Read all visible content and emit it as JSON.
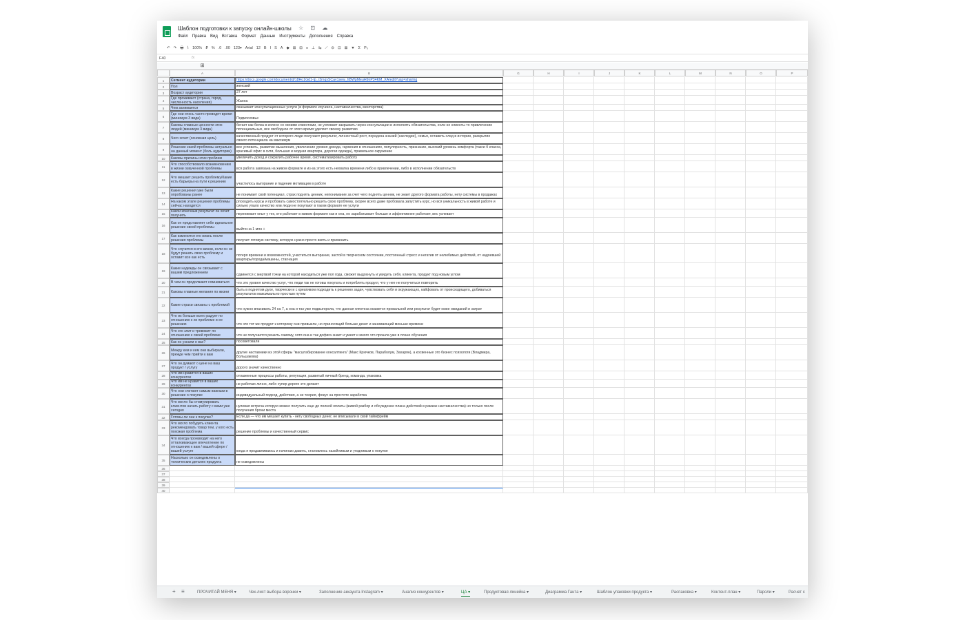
{
  "title": "Шаблон подготовки к запуску онлайн-школы",
  "title_icons": "☆ ⊡ ☁",
  "menu": [
    "Файл",
    "Правка",
    "Вид",
    "Вставка",
    "Формат",
    "Данные",
    "Инструменты",
    "Дополнения",
    "Справка"
  ],
  "toolbar": [
    "↶",
    "↷",
    "🖶",
    "⌇",
    "100%",
    "₽",
    "%",
    ".0",
    ".00",
    "123▾",
    "Arial",
    "12",
    "B",
    "I",
    "S",
    "A",
    "◆",
    "⊞",
    "⊟",
    "≡",
    "⊥",
    "⇆",
    "⟋",
    "⊖",
    "⊡",
    "⊠",
    "▼",
    "Σ",
    "Р₀"
  ],
  "formula": {
    "cell_ref": "F40",
    "fx": "fx"
  },
  "columns": [
    "A",
    "B",
    "G",
    "H",
    "I",
    "J",
    "K",
    "L",
    "M",
    "N",
    "O",
    "P"
  ],
  "rows": [
    {
      "n": "1",
      "q": "Сегмент аудитории",
      "a": "https://docs.google.com/document/d/18Ho1Gd1-lp_r3mqySCav1sew_hBWpMeuH9nP34KM_XA/edit?usp=sharing"
    },
    {
      "n": "2",
      "q": "Пол",
      "a": "женский"
    },
    {
      "n": "3",
      "q": "Возраст аудитории",
      "a": "27 лет"
    },
    {
      "n": "4",
      "q": "Где проживают (страна, город, численность населения)",
      "a": "Жанна"
    },
    {
      "n": "5",
      "q": "Чем занимается",
      "a": "оказывает консультационные услуги (в формате коучинга, наставничества, менторства)"
    },
    {
      "n": "6",
      "q": "Где они очень часто проводят время (минимум 3 вида)",
      "a": "Подмосковье"
    },
    {
      "n": "7",
      "q": "Каковы главные ценности этих людей (минимум 3 вида)",
      "a": "бегает как белка в колесе со своими клиентами, не успевает закрывать через консультации и исполнять обязательства, если не клиенты то привлечение потенциальных, все свободное от этого время уделяет своему развитию"
    },
    {
      "n": "8",
      "q": "Чего хочет (основная цель)",
      "a": "качественный продукт от которого люди получают результат, личностный рост, передача знаний (наследие), семья, оставить след в истории, раскрытие своего потенциала на максимум"
    },
    {
      "n": "9",
      "q": "Решение какой проблемы актуально на данный момент (боль аудитории)",
      "a": "все успевать, развитие мышления, увеличение уровня дохода, гармония в отношениях, популярность, признание, высокий уровень комфорта (такси б класса, красивый офис в сити, большая и модная квартира, дорогая одежда), правильное окружение"
    },
    {
      "n": "10",
      "q": "Каковы причины этих проблем",
      "a": "увеличить доход и сократить рабочее время, систематизировать работу"
    },
    {
      "n": "11",
      "q": "Что способствовало возникновению в жизни озвученной проблемы",
      "a": "вся работа завязана на живом формате и из-за этого есть нехватка времени либо в привлечении, либо в исполнении обязательств"
    },
    {
      "n": "12",
      "q": "Что мешает решить проблему/Какие есть барьеры на пути к решению",
      "a": "участилось выгорание и падение мотивации в работе"
    },
    {
      "n": "13",
      "q": "Какие решения уже были опробованы ранее",
      "a": "не понимает свой потенциал, страх поднять ценник, непонимание за счет чего поднять ценник, не знает другого формата работы, нету системы в продажах"
    },
    {
      "n": "14",
      "q": "На каком этапе решения проблемы сейчас находится",
      "a": "рпоходить курсы и пробовать самостоятельно решить свою проблему, скорее всего даже пробовала запустить курс, но вся уникальность в живой работе и сильно упало качество или люди не покупают в таком формате ее услуги"
    },
    {
      "n": "15",
      "q": "Какой конечный результат он хочет получить",
      "a": "перенимает опыт у тех, кто работает в живом формате как и она, но зарабатывает больше и эффективнее работает, вес успевает"
    },
    {
      "n": "16",
      "q": "Как он представляет себе идеальное решение своей проблемы",
      "a": "выйти на 1 млн +"
    },
    {
      "n": "17",
      "q": "Как изменится его жизнь после решения проблемы",
      "a": "получит готовую систему, которую нужно просто взять и применить"
    },
    {
      "n": "18",
      "q": "Что случится в его жизни, если он не будут решать свою проблему и оставит все как есть",
      "a": "потеря времени и возможностей, участиться выгорание, застой в творческом состоянии, постоянный стресс и негатив от нелюбимых действий, от надоевшей квартиры/города/машины, стагнация"
    },
    {
      "n": "19",
      "q": "Какие надежды он связывает с вашим предложением",
      "a": "сдвинется с мертвой точки на которой находиться уже пол года, сможет выдохнуть и увидеть себя, клиента, продукт под новым углом"
    },
    {
      "n": "20",
      "q": "В чем он продолжают сомневаться",
      "a": "что это уровня качество услуг, что люди так не готовы покупать и потреблять продукт, что у нее не получиться повторить"
    },
    {
      "n": "21",
      "q": "Каковы главные желания по жизни",
      "a": "быть в поднятом духе, творчески и с креативом подходить к решению задач, чувствовать себя и окружающих, кайфовать от происходящего, добиваться результатов максимально простым путем"
    },
    {
      "n": "22",
      "q": "Какие страхи связаны с проблемой",
      "a": "что нужно впахивать 24 на 7, а она и так уже подвыгорела, что данная гипотеза окажется провальной или результат будет ниже ожиданий и затрат"
    },
    {
      "n": "23",
      "q": "Что их больше всего радует по отношению к их проблеме и ее решению",
      "a": "что это тот же продукт к которому они привыкли, но приносящий больше денег и занимающий меньше времени"
    },
    {
      "n": "24",
      "q": "Что его злит и тревожит по отношению к своей проблеме",
      "a": "что не получается решить самому, хотя она и так дофига знает и умеет и много что прошла уже в плане обучения"
    },
    {
      "n": "25",
      "q": "Как он узнали о вас?",
      "a": "посоветовали"
    },
    {
      "n": "26",
      "q": "Между кем и кем они выбирали, прежде чем прийти к вам",
      "a": "другие наставники из этой сферы \"масштабирование консалтинга\" (Макс Крючков, Параболум, Захарян), а косвенные это бизнес психологи (Владмира, Большакова)"
    },
    {
      "n": "27",
      "q": "Что он думают о цене на ваш продукт / услугу",
      "a": "дорого значит качественно"
    },
    {
      "n": "28",
      "q": "Что им нравится в ваших конкурентах",
      "a": "отлаженные процессы работы, репутация, развитый личный бренд, команда, упаковка"
    },
    {
      "n": "29",
      "q": "Что им не нравится в ваших конкурентах",
      "a": "не работаю лично, либо супер дорого это делают"
    },
    {
      "n": "30",
      "q": "Что они считают самым важным в решение о покупке",
      "a": "индивидуальный подход, действия, а не теория, фокус на простоте заработка"
    },
    {
      "n": "31",
      "q": "Что могло бы стимулировать клиентов начать работу с вами уже сегодня",
      "a": "нулевая встреча которую можно получить еще до полной оплаты (живой разбор и обсуждение плана действий в рамках наставничества) но только после получения брони места"
    },
    {
      "n": "32",
      "q": "Готовы ли они к покупке?",
      "a": "Если да — что им мешает купить - нету свободных денег, не вписывали в свой таймфрейм"
    },
    {
      "n": "33",
      "q": "Что могло побудить клиента рекомендовать товар тем, у кого есть похожая проблема",
      "a": "решение проблемы и качественный сервис"
    },
    {
      "n": "34",
      "q": "Что всегда производит на него отталкивающее впечатление по отношению к вам / вашей сфере / вашей услуге",
      "a": "когда я продавливаюсь и начинаю давить, становлюсь назойливым и угодливым о покупке"
    },
    {
      "n": "35",
      "q": "Насколько он осведомлены о технических деталях продукта",
      "a": "не осведомлены"
    }
  ],
  "empty_rows": [
    "36",
    "37",
    "38",
    "39",
    "40"
  ],
  "tabs": [
    "ПРОЧИТАЙ МЕНЯ",
    "Чек-лист выбора воронки",
    "Заполнение аккаунта Instagram",
    "Анализ конкурентов",
    "ЦА",
    "Продуктовая линейка",
    "Диаграмма Ганта",
    "Шаблон упаковки продукта",
    "Распаковка",
    "Контент-план",
    "Пароли",
    "Расчет с"
  ],
  "tab_icons": {
    "add": "+",
    "list": "≡"
  },
  "colors": {
    "header_fill": "#c9daf8",
    "active_tab": "#188038",
    "link": "#1155cc",
    "logo": "#0f9d58"
  }
}
